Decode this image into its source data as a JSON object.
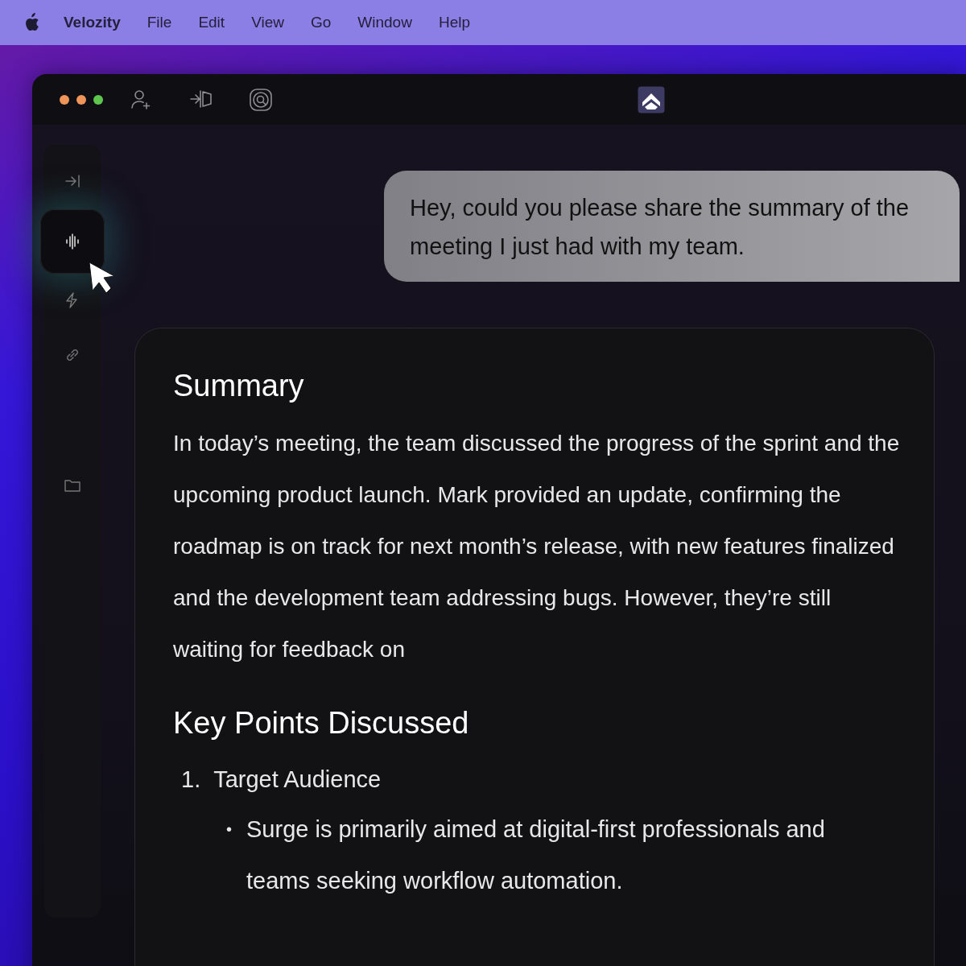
{
  "menu_bar": {
    "app_name": "Velozity",
    "items": [
      "File",
      "Edit",
      "View",
      "Go",
      "Window",
      "Help"
    ]
  },
  "window": {
    "traffic_lights": [
      {
        "color": "#f0955a"
      },
      {
        "color": "#f0955a"
      },
      {
        "color": "#5ec64f"
      }
    ]
  },
  "sidebar": {
    "items": [
      {
        "kind": "collapse",
        "selected": false
      },
      {
        "kind": "voice",
        "selected": true
      },
      {
        "kind": "bolt",
        "selected": false
      },
      {
        "kind": "link",
        "selected": false
      },
      {
        "kind": "folder",
        "selected": false
      }
    ]
  },
  "chat": {
    "message": "Hey, could you please share the summary of the meeting I just had with my team.",
    "response": {
      "summary_heading": "Summary",
      "summary": "In today’s meeting, the team discussed the progress of the sprint and the upcoming product launch. Mark provided an update, confirming the roadmap is on track for next month’s release, with new features finalized and the development team addressing bugs. However, they’re still waiting for feedback on",
      "points_heading": "Key Points Discussed",
      "points": [
        {
          "number": "1.",
          "title": "Target Audience",
          "children": [
            {
              "bullet": "•",
              "text": "Surge is primarily aimed at digital-first professionals and teams seeking workflow automation."
            }
          ]
        }
      ]
    }
  }
}
